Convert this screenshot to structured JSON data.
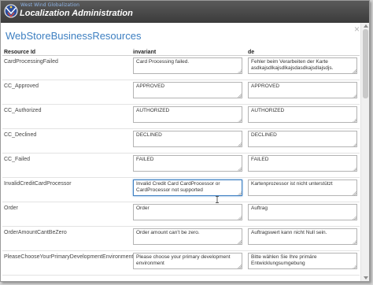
{
  "window": {
    "brand": "West Wind Globalization",
    "title": "Localization Administration"
  },
  "page": {
    "title": "WebStoreBusinessResources",
    "close_glyph": "×"
  },
  "table": {
    "headers": [
      "Resource Id",
      "invariant",
      "de"
    ],
    "rows": [
      {
        "id": "CardProcessingFailed",
        "invariant": "Card Processing failed.",
        "de": "Fehler beim Verarbeiten der Karte asdkajsdlkajsdlkajsdasdkajsdlajsdjs."
      },
      {
        "id": "CC_Approved",
        "invariant": "APPROVED",
        "de": "APPROVED"
      },
      {
        "id": "CC_Authorized",
        "invariant": "AUTHORIZED",
        "de": "AUTHORIZED"
      },
      {
        "id": "CC_Declined",
        "invariant": "DECLINED",
        "de": "DECLINED"
      },
      {
        "id": "CC_Failed",
        "invariant": "FAILED",
        "de": "FAILED"
      },
      {
        "id": "InvalidCreditCardProcessor",
        "invariant": "Invalid Credit Card CardProcessor or CardProcessor not supported",
        "de": "Kartenprozessor ist nicht unterstützt"
      },
      {
        "id": "Order",
        "invariant": "Order",
        "de": "Auftrag"
      },
      {
        "id": "OrderAmountCantBeZero",
        "invariant": "Order amount can't be zero.",
        "de": "Auftragswert kann nicht Null sein."
      },
      {
        "id": "PleaseChooseYourPrimaryDevelopmentEnvironment",
        "invariant": "Please choose your primary development environment",
        "de": "Bitte wählen Sie Ihre primäre Entwicklungsumgebung"
      }
    ],
    "active_cell": {
      "row": 5,
      "column": "invariant"
    }
  },
  "icons": {
    "logo": "west-wind-logo-icon",
    "close": "close-icon",
    "cursor": "text-cursor-icon"
  },
  "colors": {
    "titlebar": "#4a4a4a",
    "accent": "#3d7fc1",
    "border": "#b3b3b3"
  }
}
